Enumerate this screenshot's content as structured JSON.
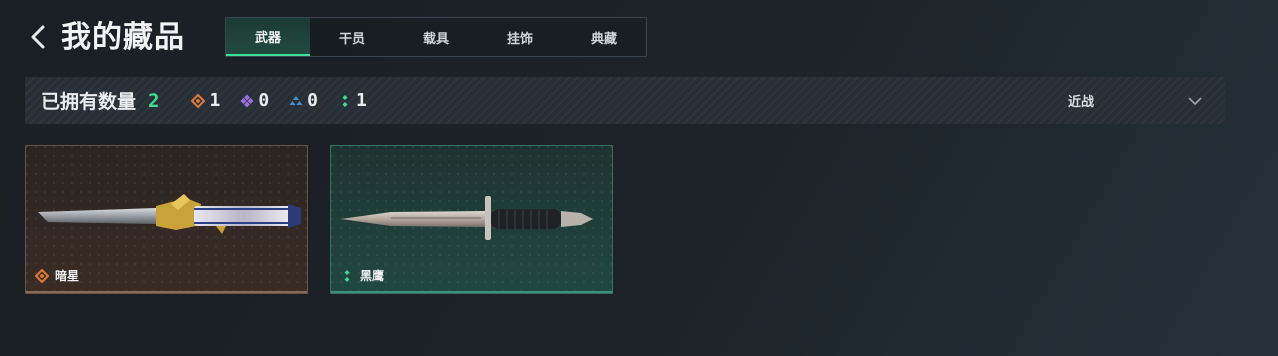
{
  "header": {
    "title": "我的藏品"
  },
  "tabs": [
    {
      "label": "武器",
      "active": true
    },
    {
      "label": "干员",
      "active": false
    },
    {
      "label": "载具",
      "active": false
    },
    {
      "label": "挂饰",
      "active": false
    },
    {
      "label": "典藏",
      "active": false
    }
  ],
  "summary": {
    "label": "已拥有数量",
    "total": "2",
    "rarities": [
      {
        "icon": "orange-diamond-icon",
        "color": "#e07b3c",
        "count": "1"
      },
      {
        "icon": "purple-diamond-icon",
        "color": "#9b6fe0",
        "count": "0"
      },
      {
        "icon": "blue-triangle-icon",
        "color": "#4a8fd6",
        "count": "0"
      },
      {
        "icon": "green-dots-icon",
        "color": "#3ddc97",
        "count": "1"
      }
    ],
    "sort": {
      "label": "近战",
      "icon": "chevron-down-icon"
    }
  },
  "items": [
    {
      "name": "暗星",
      "rarity_icon": "orange-diamond-icon",
      "rarity_color": "#e07b3c"
    },
    {
      "name": "黑鹰",
      "rarity_icon": "green-dots-icon",
      "rarity_color": "#3ddc97"
    }
  ],
  "colors": {
    "accent": "#3ddc97",
    "background": "#1c2228"
  }
}
